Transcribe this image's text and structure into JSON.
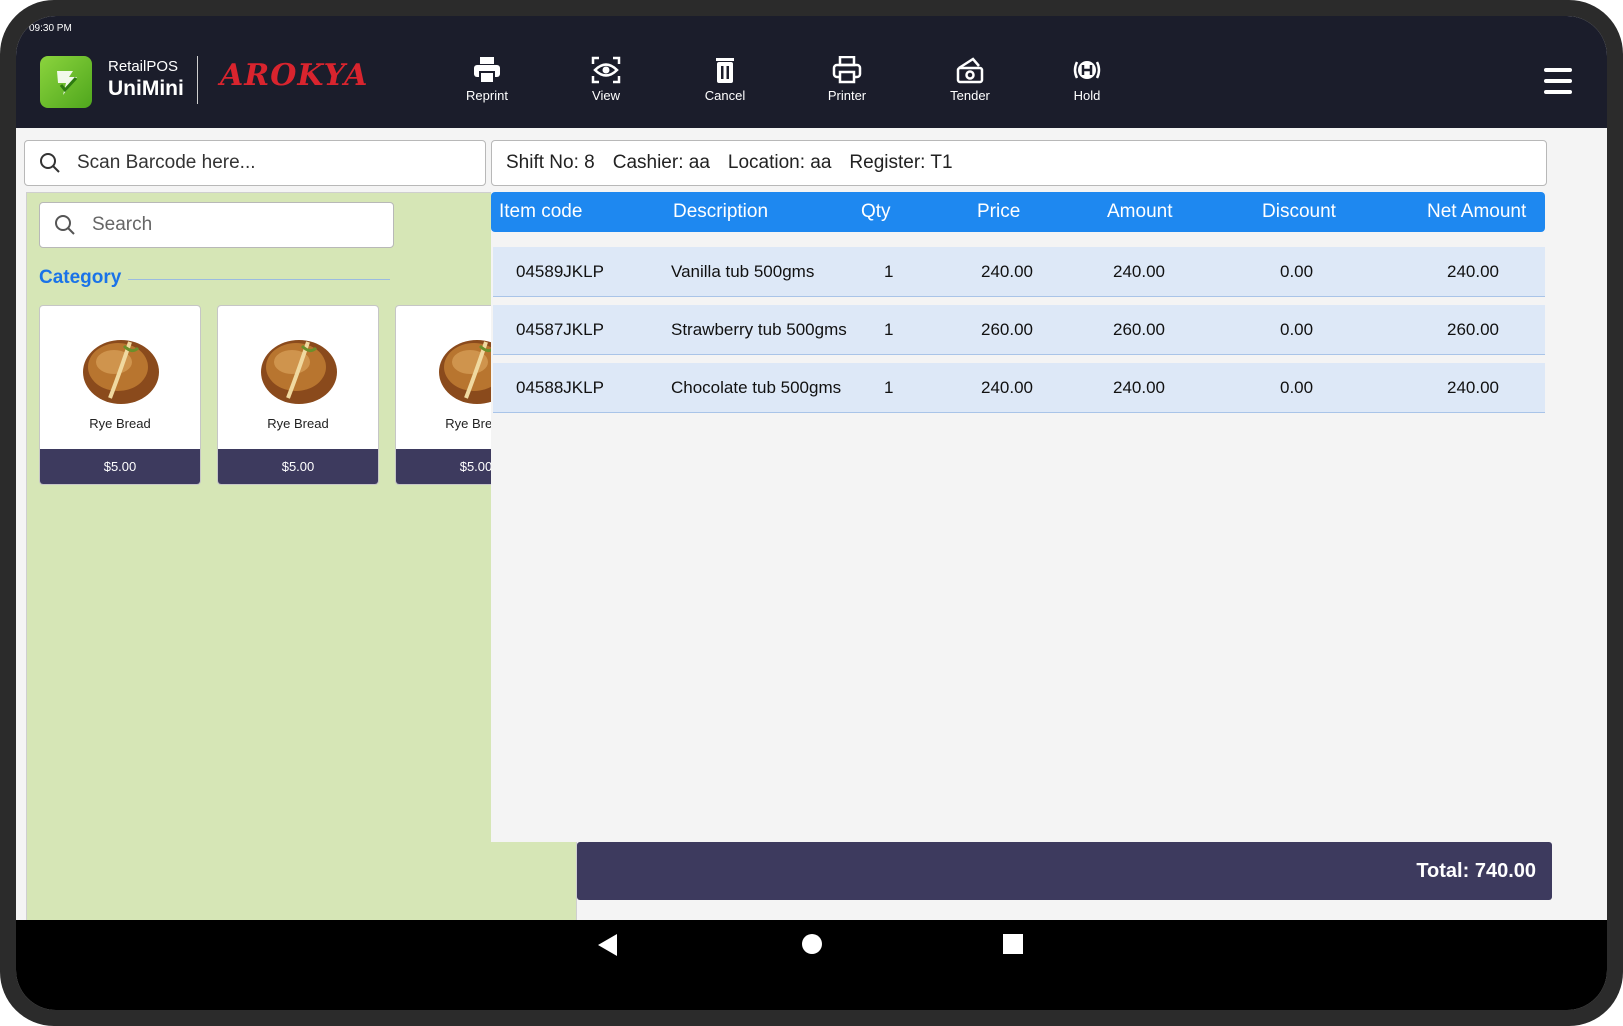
{
  "status_bar": {
    "time": "09:30 PM"
  },
  "brand": {
    "line1": "RetailPOS",
    "line2": "UniMini",
    "partner": "AROKYA"
  },
  "toolbar": [
    {
      "label": "Reprint",
      "icon": "printer-icon"
    },
    {
      "label": "View",
      "icon": "eye-icon"
    },
    {
      "label": "Cancel",
      "icon": "trash-icon"
    },
    {
      "label": "Printer",
      "icon": "printer-icon"
    },
    {
      "label": "Tender",
      "icon": "cash-icon"
    },
    {
      "label": "Hold",
      "icon": "hold-icon"
    }
  ],
  "barcode": {
    "placeholder": "Scan Barcode here..."
  },
  "info": {
    "shift": "Shift No: 8",
    "cashier": "Cashier: aa",
    "location": "Location: aa",
    "register": "Register: T1"
  },
  "search": {
    "placeholder": "Search"
  },
  "category": {
    "title": "Category"
  },
  "products": [
    {
      "name": "Rye Bread",
      "price": "$5.00"
    },
    {
      "name": "Rye Bread",
      "price": "$5.00"
    },
    {
      "name": "Rye Bread",
      "price": "$5.00"
    }
  ],
  "table": {
    "headers": [
      "Item code",
      "Description",
      "Qty",
      "Price",
      "Amount",
      "Discount",
      "Net Amount"
    ],
    "rows": [
      [
        "04589JKLP",
        "Vanilla tub 500gms",
        "1",
        "240.00",
        "240.00",
        "0.00",
        "240.00"
      ],
      [
        "04587JKLP",
        "Strawberry tub 500gms",
        "1",
        "260.00",
        "260.00",
        "0.00",
        "260.00"
      ],
      [
        "04588JKLP",
        "Chocolate tub 500gms",
        "1",
        "240.00",
        "240.00",
        "0.00",
        "240.00"
      ]
    ]
  },
  "total": {
    "label": "Total: 740.00"
  },
  "colors": {
    "topbar": "#1b1d2b",
    "accent_blue": "#1e88f0",
    "panel_green": "#d6e6b6",
    "dark_purple": "#3d3a5e",
    "brand_red": "#d9242e"
  }
}
